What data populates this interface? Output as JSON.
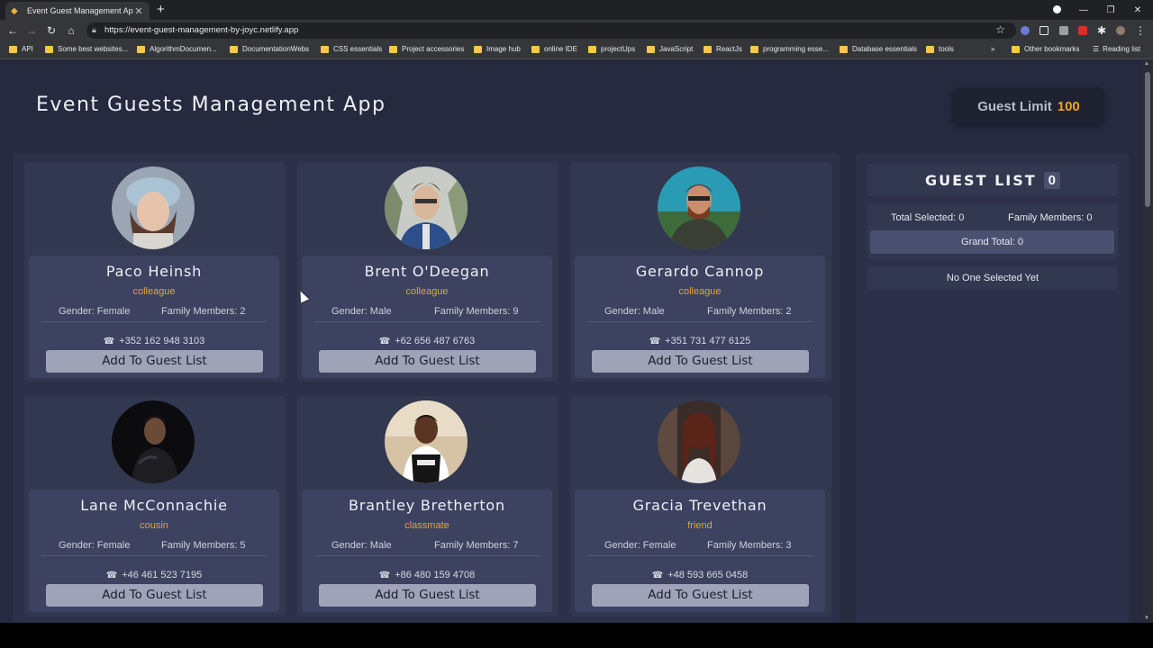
{
  "browser": {
    "tab_title": "Event Guest Management App",
    "tab_close": "✕",
    "new_tab": "+",
    "url": "https://event-guest-management-by-joyc.netlify.app",
    "bookmarks": [
      {
        "label": "API"
      },
      {
        "label": "Some best websites..."
      },
      {
        "label": "AlgorithmDocumen..."
      },
      {
        "label": "DocumentationWebs"
      },
      {
        "label": "CSS essentials"
      },
      {
        "label": "Project accessories"
      },
      {
        "label": "Image hub"
      },
      {
        "label": "online IDE"
      },
      {
        "label": "projectUps"
      },
      {
        "label": "JavaScript"
      },
      {
        "label": "ReactJs"
      },
      {
        "label": "programming esse..."
      },
      {
        "label": "Database essentials"
      },
      {
        "label": "tools"
      }
    ],
    "overflow": "»",
    "other_bookmarks": "Other bookmarks",
    "reading_list": "Reading list"
  },
  "header": {
    "title": "Event Guests Management App",
    "limit_label": "Guest Limit",
    "limit_value": "100"
  },
  "guests": [
    {
      "name": "Paco Heinsh",
      "relation": "colleague",
      "gender": "Gender: Female",
      "family": "Family Members: 2",
      "phone": "+352 162 948 3103",
      "button": "Add To Guest List"
    },
    {
      "name": "Brent O'Deegan",
      "relation": "colleague",
      "gender": "Gender: Male",
      "family": "Family Members: 9",
      "phone": "+62 656 487 6763",
      "button": "Add To Guest List"
    },
    {
      "name": "Gerardo Cannop",
      "relation": "colleague",
      "gender": "Gender: Male",
      "family": "Family Members: 2",
      "phone": "+351 731 477 6125",
      "button": "Add To Guest List"
    },
    {
      "name": "Lane McConnachie",
      "relation": "cousin",
      "gender": "Gender: Female",
      "family": "Family Members: 5",
      "phone": "+46 461 523 7195",
      "button": "Add To Guest List"
    },
    {
      "name": "Brantley Bretherton",
      "relation": "classmate",
      "gender": "Gender: Male",
      "family": "Family Members: 7",
      "phone": "+86 480 159 4708",
      "button": "Add To Guest List"
    },
    {
      "name": "Gracia Trevethan",
      "relation": "friend",
      "gender": "Gender: Female",
      "family": "Family Members: 3",
      "phone": "+48 593 665 0458",
      "button": "Add To Guest List"
    }
  ],
  "guest_list": {
    "title": "GUEST LIST",
    "count": "0",
    "total_selected": "Total Selected: 0",
    "family_members": "Family Members: 0",
    "grand_total": "Grand Total: 0",
    "empty_message": "No One Selected Yet"
  },
  "colors": {
    "accent": "#e8a23a",
    "background": "#252a3f",
    "panel": "#2c3149"
  }
}
